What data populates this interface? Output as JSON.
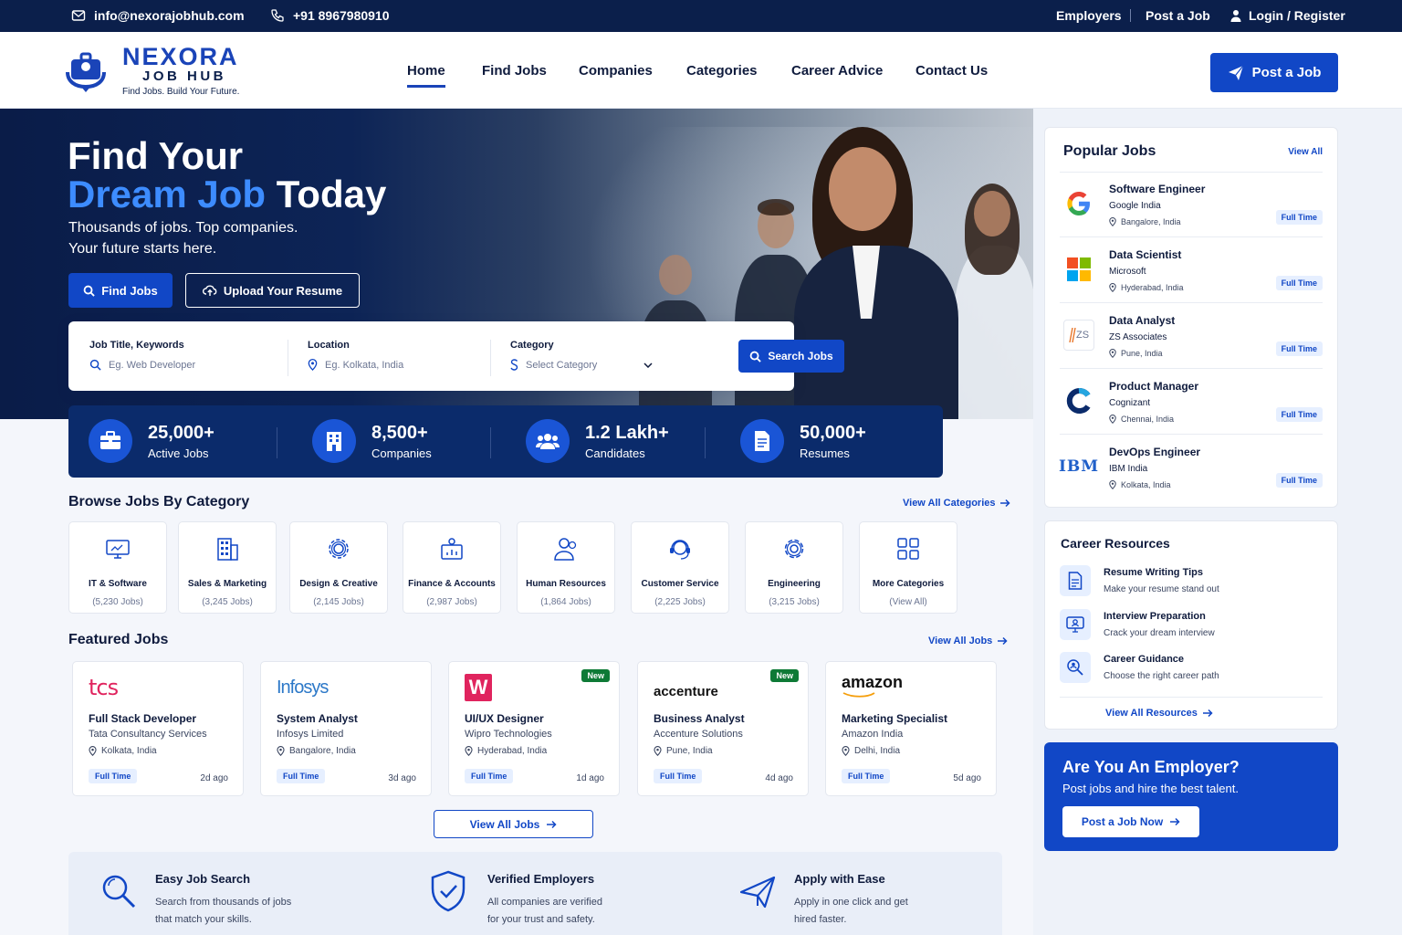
{
  "topbar": {
    "email": "info@nexorajobhub.com",
    "phone": "+91 8967980910",
    "employers": "Employers",
    "post_job": "Post a Job",
    "login": "Login / Register"
  },
  "brand": {
    "name": "NEXORA",
    "sub": "JOB HUB",
    "tagline": "Find Jobs. Build Your Future.",
    "primary_color": "#1147c6",
    "navy_color": "#0b1f4b"
  },
  "nav": {
    "items": [
      "Home",
      "Find Jobs",
      "Companies",
      "Categories",
      "Career Advice",
      "Contact Us"
    ],
    "active": "Home",
    "cta": "Post a Job"
  },
  "hero": {
    "title_line1": "Find Your",
    "title_accent": "Dream Job",
    "title_rest": " Today",
    "sub_line1": "Thousands of jobs. Top companies.",
    "sub_line2": "Your future starts here.",
    "find_btn": "Find Jobs",
    "upload_btn": "Upload Your Resume"
  },
  "search": {
    "keyword_label": "Job Title, Keywords",
    "keyword_placeholder": "Eg. Web Developer",
    "location_label": "Location",
    "location_placeholder": "Eg. Kolkata, India",
    "category_label": "Category",
    "category_placeholder": "Select Category",
    "button": "Search Jobs"
  },
  "stats": [
    {
      "num": "25,000+",
      "label": "Active Jobs",
      "icon": "briefcase-icon"
    },
    {
      "num": "8,500+",
      "label": "Companies",
      "icon": "building-icon"
    },
    {
      "num": "1.2 Lakh+",
      "label": "Candidates",
      "icon": "users-icon"
    },
    {
      "num": "50,000+",
      "label": "Resumes",
      "icon": "document-icon"
    }
  ],
  "categories": {
    "title": "Browse Jobs By Category",
    "view_all": "View All Categories",
    "items": [
      {
        "name": "IT & Software",
        "count": "(5,230 Jobs)",
        "icon": "monitor-icon"
      },
      {
        "name": "Sales & Marketing",
        "count": "(3,245 Jobs)",
        "icon": "building-icon"
      },
      {
        "name": "Design & Creative",
        "count": "(2,145 Jobs)",
        "icon": "gear-icon"
      },
      {
        "name": "Finance & Accounts",
        "count": "(2,987 Jobs)",
        "icon": "accounts-icon"
      },
      {
        "name": "Human Resources",
        "count": "(1,864 Jobs)",
        "icon": "people-icon"
      },
      {
        "name": "Customer Service",
        "count": "(2,225 Jobs)",
        "icon": "headset-icon"
      },
      {
        "name": "Engineering",
        "count": "(3,215 Jobs)",
        "icon": "gear-icon"
      },
      {
        "name": "More Categories",
        "count": "(View All)",
        "icon": "grid-icon"
      }
    ]
  },
  "featured": {
    "title": "Featured Jobs",
    "view_all": "View All Jobs",
    "button": "View All Jobs",
    "jobs": [
      {
        "logo": "tcs",
        "title": "Full Stack Developer",
        "company": "Tata Consultancy Services",
        "location": "Kolkata, India",
        "type": "Full Time",
        "ago": "2d ago",
        "new": ""
      },
      {
        "logo": "Infosys",
        "title": "System Analyst",
        "company": "Infosys Limited",
        "location": "Bangalore, India",
        "type": "Full Time",
        "ago": "3d ago",
        "new": ""
      },
      {
        "logo": "W",
        "title": "UI/UX Designer",
        "company": "Wipro Technologies",
        "location": "Hyderabad, India",
        "type": "Full Time",
        "ago": "1d ago",
        "new": "New"
      },
      {
        "logo": "accenture",
        "title": "Business Analyst",
        "company": "Accenture Solutions",
        "location": "Pune, India",
        "type": "Full Time",
        "ago": "4d ago",
        "new": "New"
      },
      {
        "logo": "amazon",
        "title": "Marketing Specialist",
        "company": "Amazon India",
        "location": "Delhi, India",
        "type": "Full Time",
        "ago": "5d ago",
        "new": ""
      }
    ]
  },
  "features": [
    {
      "title": "Easy Job Search",
      "line1": "Search from thousands of jobs",
      "line2": "that match your skills.",
      "icon": "search-icon"
    },
    {
      "title": "Verified Employers",
      "line1": "All companies are verified",
      "line2": "for your trust and safety.",
      "icon": "shield-check-icon"
    },
    {
      "title": "Apply with Ease",
      "line1": "Apply in one click and get",
      "line2": "hired faster.",
      "icon": "paper-plane-icon"
    }
  ],
  "popular": {
    "title": "Popular Jobs",
    "view_all": "View All",
    "jobs": [
      {
        "title": "Software Engineer",
        "company": "Google India",
        "location": "Bangalore, India",
        "type": "Full Time",
        "logo": "google-logo"
      },
      {
        "title": "Data Scientist",
        "company": "Microsoft",
        "location": "Hyderabad, India",
        "type": "Full Time",
        "logo": "microsoft-logo"
      },
      {
        "title": "Data Analyst",
        "company": "ZS Associates",
        "location": "Pune, India",
        "type": "Full Time",
        "logo": "ZS"
      },
      {
        "title": "Product Manager",
        "company": "Cognizant",
        "location": "Chennai, India",
        "type": "Full Time",
        "logo": "cognizant-logo"
      },
      {
        "title": "DevOps Engineer",
        "company": "IBM India",
        "location": "Kolkata, India",
        "type": "Full Time",
        "logo": "IBM"
      }
    ]
  },
  "resources": {
    "title": "Career Resources",
    "view_all": "View All Resources",
    "items": [
      {
        "title": "Resume Writing Tips",
        "desc": "Make your resume stand out",
        "icon": "document-icon"
      },
      {
        "title": "Interview Preparation",
        "desc": "Crack your dream interview",
        "icon": "interview-icon"
      },
      {
        "title": "Career Guidance",
        "desc": "Choose the right career path",
        "icon": "guidance-icon"
      }
    ]
  },
  "employer": {
    "title": "Are You An Employer?",
    "desc": "Post jobs and hire the best talent.",
    "button": "Post a Job Now"
  }
}
